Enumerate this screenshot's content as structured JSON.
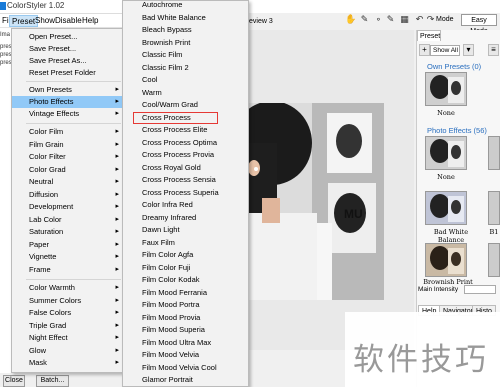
{
  "window": {
    "title": "ColorStyler 1.02"
  },
  "menubar": {
    "items": [
      "File",
      "Preset",
      "Show",
      "Disable",
      "Help"
    ],
    "active_index": 1
  },
  "left_strip": {
    "items": [
      "Ima",
      "pres",
      "pres",
      "pres"
    ]
  },
  "preset_menu": {
    "groups": [
      [
        "Open Preset...",
        "Save Preset...",
        "Save Preset As...",
        "Reset Preset Folder"
      ],
      [
        "Own Presets",
        "Photo Effects",
        "Vintage Effects"
      ],
      [
        "Color Film",
        "Film Grain",
        "Color Filter",
        "Color Grad",
        "Neutral",
        "Diffusion",
        "Development",
        "Lab Color",
        "Saturation",
        "Paper",
        "Vignette",
        "Frame"
      ],
      [
        "Color Warmth",
        "Summer Colors",
        "False Colors",
        "Triple Grad",
        "Night Effect",
        "Glow",
        "Mask"
      ]
    ],
    "highlighted": "Photo Effects"
  },
  "submenu": {
    "items": [
      "Autochrome",
      "Bad White Balance",
      "Bleach Bypass",
      "Brownish Print",
      "Classic Film",
      "Classic Film 2",
      "Cool",
      "Warm",
      "Cool/Warm Grad",
      "Cross Process",
      "Cross Process Elite",
      "Cross Process Optima",
      "Cross Process Provia",
      "Cross Royal Gold",
      "Cross Process Sensia",
      "Cross Process Superia",
      "Color Infra Red",
      "Dreamy Infrared",
      "Dawn Light",
      "Faux Film",
      "Film Color Agfa",
      "Film Color Fuji",
      "Film Color Kodak",
      "Film Mood Ferrania",
      "Film Mood Portra",
      "Film Mood Provia",
      "Film Mood Superia",
      "Film Mood Ultra Max",
      "Film Mood Velvia",
      "Film Mood Velvia Cool",
      "Glamor Portrait"
    ],
    "boxed": "Cross Process"
  },
  "toolbar": {
    "tab_label": "eview 3",
    "mode_label": "Mode",
    "mode_value": "Easy Mode"
  },
  "right_panel": {
    "tab": "Preset",
    "filter": "Show All",
    "own_presets_label": "Own Presets (0)",
    "photo_effects_label": "Photo Effects (56)",
    "thumb_labels": [
      "None",
      "None",
      "Bad White Balance",
      "B1",
      "Brownish Print"
    ],
    "intensity_label": "Main Intensity",
    "bottom_tabs": [
      "Help",
      "Navigator",
      "Histo"
    ]
  },
  "bottom_bar": {
    "close": "Close",
    "batch": "Batch..."
  },
  "watermark": "软件技巧",
  "colors": {
    "highlight": "#91c9f7",
    "boxed_outline": "#e53935",
    "section_blue": "#2a6fbf"
  }
}
